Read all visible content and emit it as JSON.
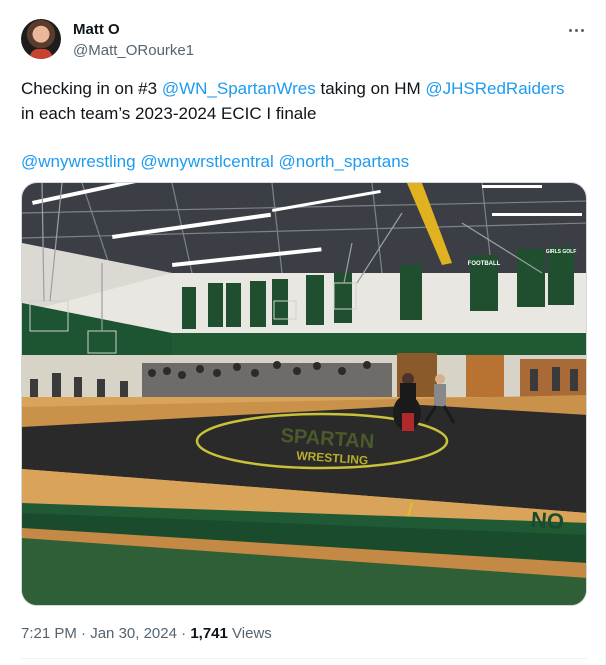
{
  "author": {
    "display_name": "Matt O",
    "handle": "@Matt_ORourke1"
  },
  "tweet": {
    "text_part1": "Checking in on #3 ",
    "mention1": "@WN_SpartanWres",
    "text_part2": " taking on HM ",
    "mention2": "@JHSRedRaiders",
    "text_part3": " in each team’s 2023-2024 ECIC I finale",
    "tags": [
      "@wnywrestling",
      "@wnywrstlcentral",
      "@north_spartans"
    ]
  },
  "media": {
    "banners": [
      "FOOTBALL",
      "GIRLS GOLF"
    ],
    "mat_text_1": "SPARTAN",
    "mat_text_2": "WRESTLING",
    "floor_text": "NO"
  },
  "meta": {
    "time": "7:21 PM",
    "separator": "·",
    "date": "Jan 30, 2024",
    "views_count": "1,741",
    "views_label": "Views"
  },
  "colors": {
    "link": "#1d9bf0",
    "secondary_text": "#536471",
    "gym_green": "#1f5a35",
    "mat": "#2a2a2a",
    "mat_logo": "#c9c13a"
  },
  "icons": {
    "more": "more-horizontal-icon"
  }
}
